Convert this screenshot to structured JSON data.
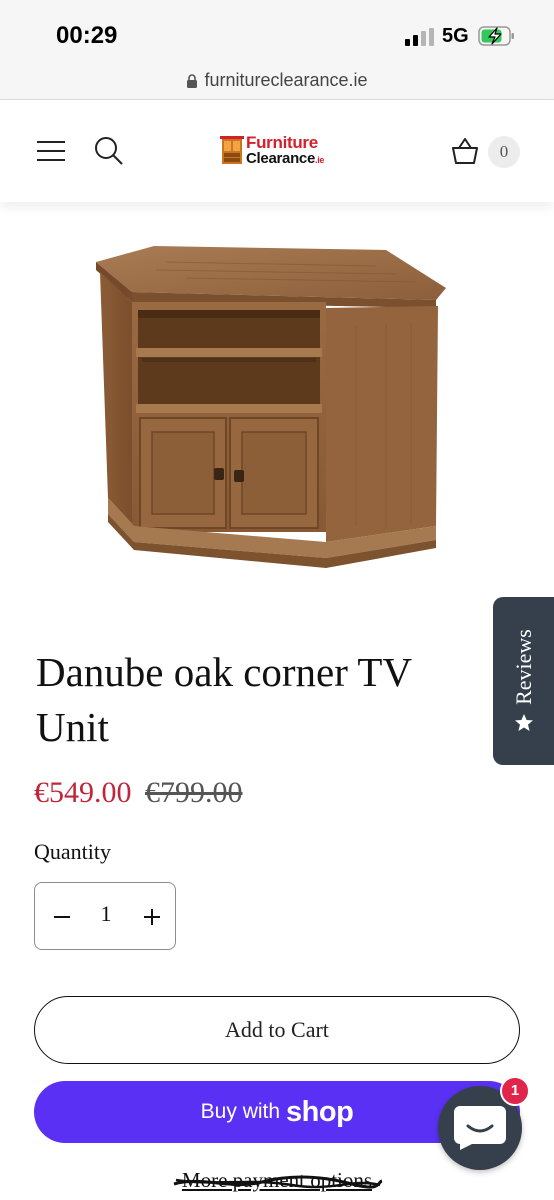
{
  "status_bar": {
    "time": "00:29",
    "network": "5G"
  },
  "browser": {
    "url": "furnitureclearance.ie"
  },
  "header": {
    "logo_line1": "Furniture",
    "logo_line2": "Clearance",
    "logo_suffix": ".ie",
    "cart_count": "0"
  },
  "product": {
    "title": "Danube oak corner TV Unit",
    "price_sale": "€549.00",
    "price_regular": "€799.00",
    "quantity_label": "Quantity",
    "quantity_value": "1"
  },
  "actions": {
    "add_to_cart": "Add to Cart",
    "buy_with": "Buy with",
    "shop_word": "shop",
    "more_payment": "More payment options"
  },
  "widgets": {
    "reviews_label": "Reviews",
    "chat_badge": "1"
  },
  "colors": {
    "sale_price": "#c0263a",
    "shop_pay": "#5a31f4",
    "reviews_tab": "#35404c",
    "badge": "#e0244a"
  }
}
